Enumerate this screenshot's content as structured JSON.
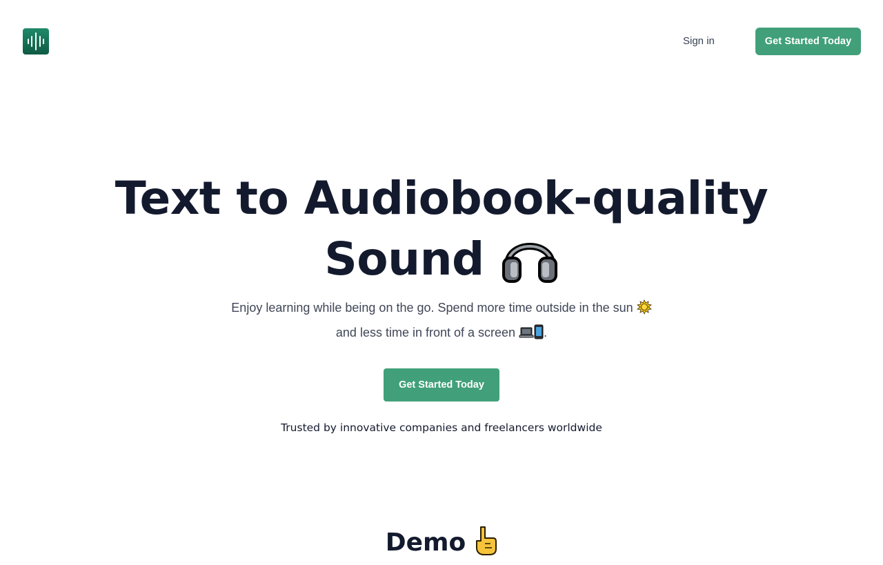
{
  "header": {
    "logo_icon": "soundwave-logo-icon",
    "signin_label": "Sign in",
    "cta_label": "Get Started Today"
  },
  "hero": {
    "title_line1": "Text to Audiobook-quality",
    "title_line2": "Sound",
    "title_icon": "headphones-icon",
    "subtitle_line1": "Enjoy learning while being on the go. Spend more time outside in the sun",
    "subtitle_line2": "and less time in front of a screen",
    "subtitle_line2_end": ".",
    "sun_icon": "sun-icon",
    "laptop_icon": "laptop-icon",
    "phone_icon": "phone-icon",
    "cta_label": "Get Started Today",
    "trusted_text": "Trusted by innovative companies and freelancers worldwide"
  },
  "demo": {
    "title": "Demo",
    "icon": "pointing-down-icon"
  },
  "colors": {
    "accent": "#41a07a",
    "logo_bg": "#16704f",
    "heading": "#141a2e",
    "body_text": "#3f4656"
  }
}
